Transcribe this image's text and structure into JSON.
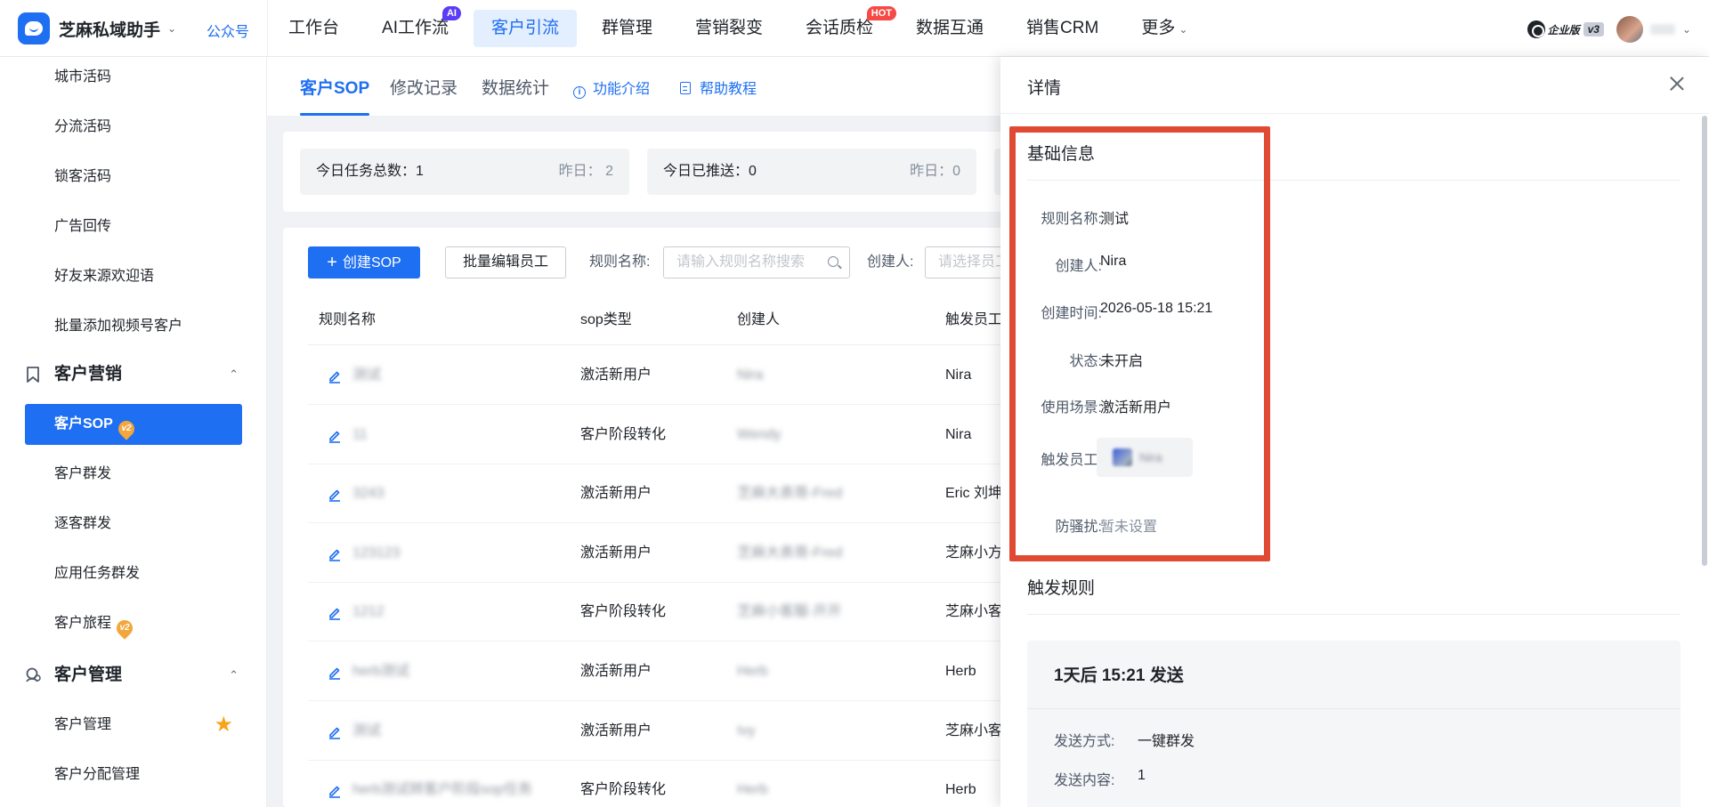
{
  "topbar": {
    "brand_name": "芝麻私域助手",
    "brand_link": "公众号",
    "nav": [
      {
        "label": "工作台",
        "badge": ""
      },
      {
        "label": "AI工作流",
        "badge": "AI"
      },
      {
        "label": "客户引流",
        "badge": ""
      },
      {
        "label": "群管理",
        "badge": ""
      },
      {
        "label": "营销裂变",
        "badge": ""
      },
      {
        "label": "会话质检",
        "badge": "HOT"
      },
      {
        "label": "数据互通",
        "badge": ""
      },
      {
        "label": "销售CRM",
        "badge": ""
      },
      {
        "label": "更多",
        "badge": ""
      }
    ],
    "active_nav": "客户引流",
    "edition": "企业版",
    "edition_version": "v3"
  },
  "sidebar": {
    "items_top": [
      "城市活码",
      "分流活码",
      "锁客活码",
      "广告回传",
      "好友来源欢迎语",
      "批量添加视频号客户"
    ],
    "group_marketing": "客户营销",
    "marketing_items": [
      {
        "label": "客户SOP",
        "tag": "v2"
      },
      {
        "label": "客户群发",
        "tag": ""
      },
      {
        "label": "逐客群发",
        "tag": ""
      },
      {
        "label": "应用任务群发",
        "tag": ""
      },
      {
        "label": "客户旅程",
        "tag": "v2"
      }
    ],
    "group_customer": "客户管理",
    "customer_items": [
      "客户管理",
      "客户分配管理"
    ]
  },
  "tabs": {
    "items": [
      "客户SOP",
      "修改记录",
      "数据统计"
    ],
    "link_intro": "功能介绍",
    "link_help": "帮助教程"
  },
  "stats": {
    "today_total_label": "今日任务总数：",
    "today_total": "1",
    "yesterday_total": "昨日： 2",
    "today_pushed_label": "今日已推送：",
    "today_pushed": "0",
    "yesterday_pushed": "昨日：0"
  },
  "toolbar": {
    "create_label": "创建SOP",
    "batch_edit_label": "批量编辑员工",
    "rule_name_label": "规则名称:",
    "rule_name_placeholder": "请输入规则名称搜索",
    "creator_label": "创建人:",
    "creator_placeholder": "请选择员工"
  },
  "table": {
    "headers": [
      "规则名称",
      "sop类型",
      "创建人",
      "触发员工"
    ],
    "rows": [
      {
        "name": "测试",
        "type": "激活新用户",
        "creator": "Nira",
        "employee": "Nira"
      },
      {
        "name": "11",
        "type": "客户阶段转化",
        "creator": "Wendy",
        "employee": "Nira"
      },
      {
        "name": "3243",
        "type": "激活新用户",
        "creator": "芝麻大表哥-Fred",
        "employee": "Eric 刘坤"
      },
      {
        "name": "123123",
        "type": "激活新用户",
        "creator": "芝麻大表哥-Fred",
        "employee": "芝麻小方"
      },
      {
        "name": "1212",
        "type": "客户阶段转化",
        "creator": "芝麻小客服-开开",
        "employee": "芝麻小客"
      },
      {
        "name": "herb测试",
        "type": "激活新用户",
        "creator": "Herb",
        "employee": "Herb"
      },
      {
        "name": "测试",
        "type": "激活新用户",
        "creator": "Ivy",
        "employee": "芝麻小客"
      },
      {
        "name": "herb测试转客户阶段sop任务",
        "type": "客户阶段转化",
        "creator": "Herb",
        "employee": "Herb"
      }
    ]
  },
  "drawer": {
    "title": "详情",
    "basic_title": "基础信息",
    "fields": {
      "rule_name_label": "规则名称:",
      "rule_name": "测试",
      "creator_label": "创建人:",
      "creator": "Nira",
      "created_at_label": "创建时间:",
      "created_at": "2026-05-18 15:21",
      "status_label": "状态:",
      "status": "未开启",
      "scene_label": "使用场景:",
      "scene": "激活新用户",
      "employee_label": "触发员工:",
      "employee": "Nira",
      "anti_label": "防骚扰:",
      "anti": "暂未设置"
    },
    "trigger_title": "触发规则",
    "rule_heading": "1天后 15:21 发送",
    "send_method_label": "发送方式:",
    "send_method": "一键群发",
    "send_content_label": "发送内容:",
    "send_content": "1"
  }
}
